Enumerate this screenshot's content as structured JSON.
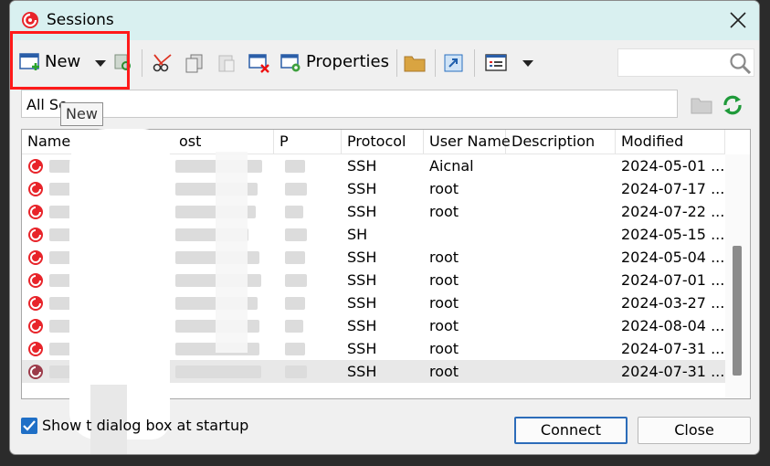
{
  "window": {
    "title": "Sessions"
  },
  "toolbar": {
    "new_label": "New",
    "properties_label": "Properties"
  },
  "folder_bar": {
    "text": "All Se"
  },
  "tooltip": {
    "text": "New"
  },
  "grid": {
    "columns": [
      "Name",
      "ost",
      "P",
      "Protocol",
      "User Name",
      "Description",
      "Modified"
    ],
    "rows": [
      {
        "protocol": "SSH",
        "user": "Aicnal",
        "description": "",
        "modified": "2024-05-01 ..."
      },
      {
        "protocol": "SSH",
        "user": "root",
        "description": "",
        "modified": "2024-07-17 ..."
      },
      {
        "protocol": "SSH",
        "user": "root",
        "description": "",
        "modified": "2024-07-22 ..."
      },
      {
        "protocol": "SH",
        "user": "",
        "description": "",
        "modified": "2024-05-15 ..."
      },
      {
        "protocol": "SSH",
        "user": "root",
        "description": "",
        "modified": "2024-05-04 ..."
      },
      {
        "protocol": "SSH",
        "user": "root",
        "description": "",
        "modified": "2024-07-01 ..."
      },
      {
        "protocol": "SSH",
        "user": "root",
        "description": "",
        "modified": "2024-03-27 ..."
      },
      {
        "protocol": "SSH",
        "user": "root",
        "description": "",
        "modified": "2024-08-04 ..."
      },
      {
        "protocol": "SSH",
        "user": "root",
        "description": "",
        "modified": "2024-07-31 ..."
      },
      {
        "protocol": "SSH",
        "user": "root",
        "description": "",
        "modified": "2024-07-31 ..."
      }
    ]
  },
  "bottom": {
    "checkbox_label": "Show t    dialog box at startup",
    "connect_label": "Connect",
    "close_label": "Close"
  },
  "colors": {
    "accent": "#1f6fc6",
    "highlight": "#ff1a1a",
    "titlebar": "#d9f0f0"
  }
}
